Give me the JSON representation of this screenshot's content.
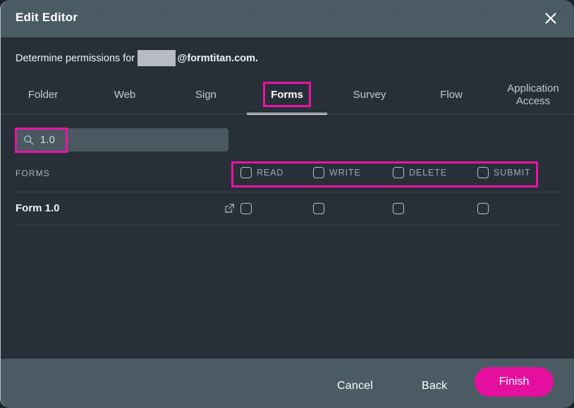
{
  "window": {
    "title": "Edit Editor",
    "close_icon": "close-icon"
  },
  "subtitle": {
    "prefix": "Determine permissions for",
    "redacted_user": "",
    "domain": "@formtitan.com."
  },
  "tabs": [
    {
      "label": "Folder",
      "active": false
    },
    {
      "label": "Web",
      "active": false
    },
    {
      "label": "Sign",
      "active": false
    },
    {
      "label": "Forms",
      "active": true
    },
    {
      "label": "Survey",
      "active": false
    },
    {
      "label": "Flow",
      "active": false
    },
    {
      "label": "Application Access",
      "active": false
    }
  ],
  "search": {
    "icon": "search-icon",
    "value": "1.0",
    "placeholder": ""
  },
  "table": {
    "section_label": "FORMS",
    "columns": [
      {
        "label": "READ",
        "checked": false
      },
      {
        "label": "WRITE",
        "checked": false
      },
      {
        "label": "DELETE",
        "checked": false
      },
      {
        "label": "SUBMIT",
        "checked": false
      }
    ],
    "rows": [
      {
        "name": "Form 1.0",
        "link_icon": "external-link-icon",
        "permissions": [
          false,
          false,
          false,
          false
        ]
      }
    ]
  },
  "footer": {
    "cancel_label": "Cancel",
    "back_label": "Back",
    "finish_label": "Finish"
  },
  "colors": {
    "accent": "#e40f9e",
    "highlight": "#ec13a6",
    "titlebar": "#4b5b64",
    "body": "#272f38"
  }
}
